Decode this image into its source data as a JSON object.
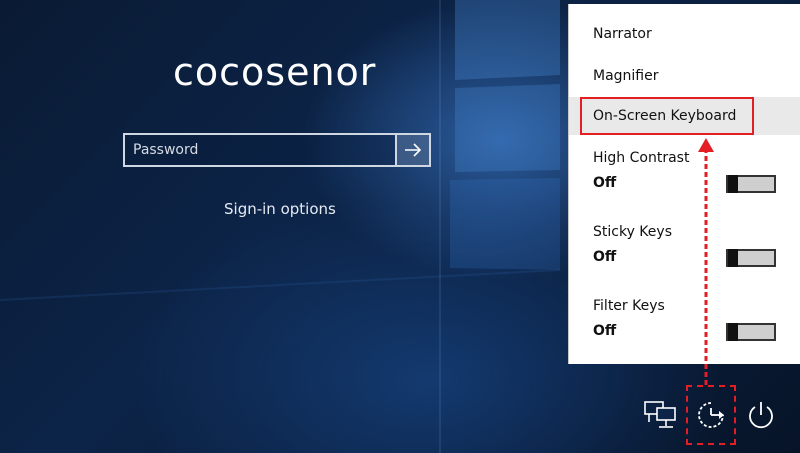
{
  "login": {
    "username": "cocosenor",
    "password_placeholder": "Password",
    "signin_options": "Sign-in options"
  },
  "ease_menu": {
    "items": [
      {
        "label": "Narrator"
      },
      {
        "label": "Magnifier"
      },
      {
        "label": "On-Screen Keyboard"
      }
    ],
    "toggles": [
      {
        "label": "High Contrast",
        "state": "Off"
      },
      {
        "label": "Sticky Keys",
        "state": "Off"
      },
      {
        "label": "Filter Keys",
        "state": "Off"
      }
    ]
  },
  "tray": {
    "icons": [
      "network-icon",
      "ease-of-access-icon",
      "power-icon"
    ]
  },
  "colors": {
    "annotation": "#e31e24",
    "background": "#0c2448",
    "panel": "#ffffff"
  }
}
